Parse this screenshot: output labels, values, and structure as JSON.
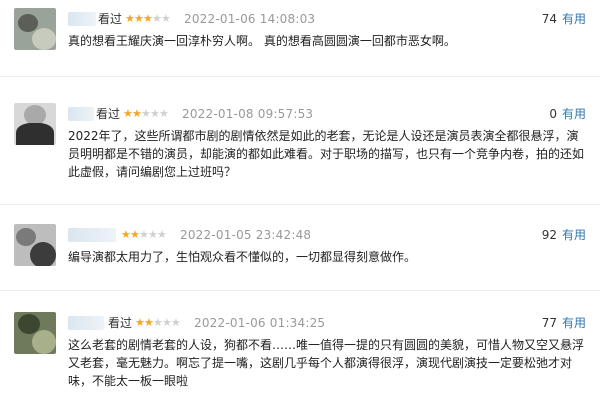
{
  "reviews": [
    {
      "seen_label": "看过",
      "rating": 3,
      "time": "2022-01-06 14:08:03",
      "votes": "74",
      "useful_label": "有用",
      "text": "真的想看王耀庆演一回淳朴穷人啊。 真的想看高圆圆演一回都市恶女啊。"
    },
    {
      "seen_label": "看过",
      "rating": 2,
      "time": "2022-01-08 09:57:53",
      "votes": "0",
      "useful_label": "有用",
      "text": "2022年了，这些所谓都市剧的剧情依然是如此的老套，无论是人设还是演员表演全都很悬浮，演员明明都是不错的演员，却能演的都如此难看。对于职场的描写，也只有一个竞争内卷，拍的还如此虚假，请问编剧您上过班吗？"
    },
    {
      "seen_label": "",
      "rating": 2,
      "time": "2022-01-05 23:42:48",
      "votes": "92",
      "useful_label": "有用",
      "text": "编导演都太用力了，生怕观众看不懂似的，一切都显得刻意做作。"
    },
    {
      "seen_label": "看过",
      "rating": 2,
      "time": "2022-01-06 01:34:25",
      "votes": "77",
      "useful_label": "有用",
      "text": "这么老套的剧情老套的人设，狗都不看……唯一值得一提的只有圆圆的美貌，可惜人物又空又悬浮又老套，毫无魅力。啊忘了提一嘴，这剧几乎每个人都演得很浮，演现代剧演技一定要松弛才对味，不能太一板一眼啦"
    }
  ],
  "colors": {
    "star_on": "#f5a623",
    "star_off": "#d0d0d0",
    "useful_link": "#3377aa",
    "time": "#999999"
  }
}
